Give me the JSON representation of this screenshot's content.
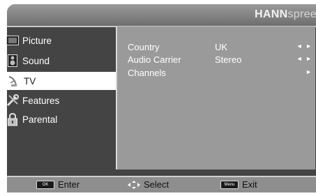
{
  "brand": {
    "bold": "HANN",
    "light": "spree"
  },
  "menu": {
    "items": [
      {
        "label": "Picture",
        "icon": "picture-icon"
      },
      {
        "label": "Sound",
        "icon": "speaker-icon"
      },
      {
        "label": "TV",
        "icon": "satellite-dish-icon"
      },
      {
        "label": "Features",
        "icon": "tools-icon"
      },
      {
        "label": "Parental",
        "icon": "lock-icon"
      }
    ],
    "active_index": 2
  },
  "settings": {
    "rows": [
      {
        "label": "Country",
        "value": "UK",
        "arrow": "◄ ►"
      },
      {
        "label": "Audio Carrier",
        "value": "Stereo",
        "arrow": "◄ ►"
      },
      {
        "label": "Channels",
        "value": "",
        "arrow": "►"
      }
    ]
  },
  "footer": {
    "enter_key": "OK",
    "enter_label": "Enter",
    "select_label": "Select",
    "exit_key": "Menu",
    "exit_label": "Exit"
  }
}
